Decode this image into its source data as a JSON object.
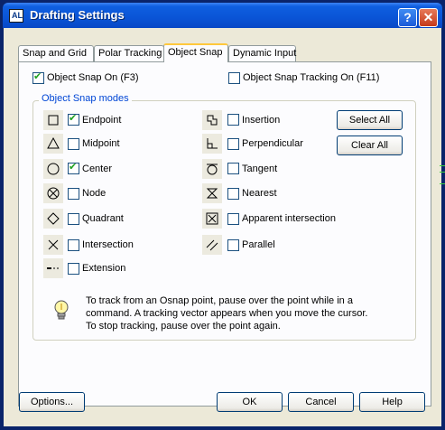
{
  "window": {
    "title": "Drafting Settings"
  },
  "tabs": [
    {
      "label": "Snap and Grid"
    },
    {
      "label": "Polar Tracking"
    },
    {
      "label": "Object Snap"
    },
    {
      "label": "Dynamic Input"
    }
  ],
  "active_tab": "Object Snap",
  "object_snap_on": {
    "label": "Object Snap On (F3)",
    "checked": true
  },
  "object_snap_tracking_on": {
    "label": "Object Snap Tracking On (F11)",
    "checked": false
  },
  "group": {
    "label": "Object Snap modes"
  },
  "modes_left": [
    {
      "label": "Endpoint",
      "checked": true,
      "icon": "endpoint-icon"
    },
    {
      "label": "Midpoint",
      "checked": false,
      "icon": "midpoint-icon"
    },
    {
      "label": "Center",
      "checked": true,
      "icon": "center-icon"
    },
    {
      "label": "Node",
      "checked": false,
      "icon": "node-icon"
    },
    {
      "label": "Quadrant",
      "checked": false,
      "icon": "quadrant-icon"
    },
    {
      "label": "Intersection",
      "checked": false,
      "icon": "intersection-icon"
    },
    {
      "label": "Extension",
      "checked": false,
      "icon": "extension-icon"
    }
  ],
  "modes_right": [
    {
      "label": "Insertion",
      "checked": false,
      "icon": "insertion-icon"
    },
    {
      "label": "Perpendicular",
      "checked": false,
      "icon": "perpendicular-icon"
    },
    {
      "label": "Tangent",
      "checked": false,
      "icon": "tangent-icon"
    },
    {
      "label": "Nearest",
      "checked": false,
      "icon": "nearest-icon"
    },
    {
      "label": "Apparent intersection",
      "checked": false,
      "icon": "apparent-intersection-icon"
    },
    {
      "label": "Parallel",
      "checked": false,
      "icon": "parallel-icon"
    }
  ],
  "buttons": {
    "select_all": "Select All",
    "clear_all": "Clear All",
    "options": "Options...",
    "ok": "OK",
    "cancel": "Cancel",
    "help": "Help"
  },
  "tip": {
    "lines": [
      "To track from an Osnap point, pause over the point while in a",
      "command.  A tracking vector appears when you move the cursor.",
      "To stop tracking, pause over the point again."
    ]
  },
  "colors": {
    "titlebar": "#0a54d6",
    "group_label": "#0046d5",
    "check": "#21a121"
  }
}
